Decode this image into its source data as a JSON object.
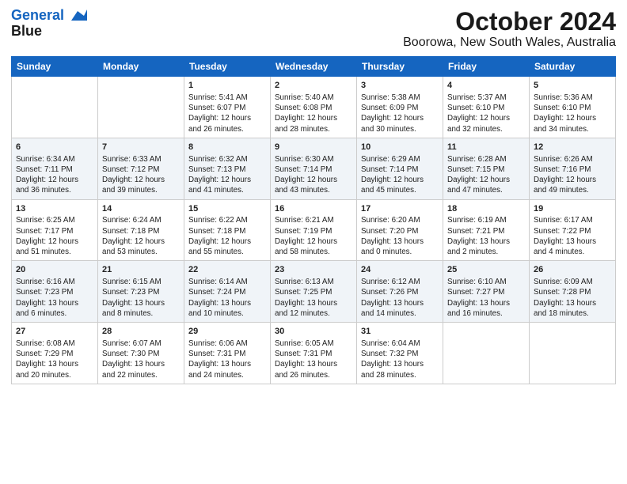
{
  "logo": {
    "line1": "General",
    "line2": "Blue"
  },
  "title": "October 2024",
  "subtitle": "Boorowa, New South Wales, Australia",
  "days_of_week": [
    "Sunday",
    "Monday",
    "Tuesday",
    "Wednesday",
    "Thursday",
    "Friday",
    "Saturday"
  ],
  "weeks": [
    [
      {
        "day": "",
        "info": ""
      },
      {
        "day": "",
        "info": ""
      },
      {
        "day": "1",
        "info": "Sunrise: 5:41 AM\nSunset: 6:07 PM\nDaylight: 12 hours and 26 minutes."
      },
      {
        "day": "2",
        "info": "Sunrise: 5:40 AM\nSunset: 6:08 PM\nDaylight: 12 hours and 28 minutes."
      },
      {
        "day": "3",
        "info": "Sunrise: 5:38 AM\nSunset: 6:09 PM\nDaylight: 12 hours and 30 minutes."
      },
      {
        "day": "4",
        "info": "Sunrise: 5:37 AM\nSunset: 6:10 PM\nDaylight: 12 hours and 32 minutes."
      },
      {
        "day": "5",
        "info": "Sunrise: 5:36 AM\nSunset: 6:10 PM\nDaylight: 12 hours and 34 minutes."
      }
    ],
    [
      {
        "day": "6",
        "info": "Sunrise: 6:34 AM\nSunset: 7:11 PM\nDaylight: 12 hours and 36 minutes."
      },
      {
        "day": "7",
        "info": "Sunrise: 6:33 AM\nSunset: 7:12 PM\nDaylight: 12 hours and 39 minutes."
      },
      {
        "day": "8",
        "info": "Sunrise: 6:32 AM\nSunset: 7:13 PM\nDaylight: 12 hours and 41 minutes."
      },
      {
        "day": "9",
        "info": "Sunrise: 6:30 AM\nSunset: 7:14 PM\nDaylight: 12 hours and 43 minutes."
      },
      {
        "day": "10",
        "info": "Sunrise: 6:29 AM\nSunset: 7:14 PM\nDaylight: 12 hours and 45 minutes."
      },
      {
        "day": "11",
        "info": "Sunrise: 6:28 AM\nSunset: 7:15 PM\nDaylight: 12 hours and 47 minutes."
      },
      {
        "day": "12",
        "info": "Sunrise: 6:26 AM\nSunset: 7:16 PM\nDaylight: 12 hours and 49 minutes."
      }
    ],
    [
      {
        "day": "13",
        "info": "Sunrise: 6:25 AM\nSunset: 7:17 PM\nDaylight: 12 hours and 51 minutes."
      },
      {
        "day": "14",
        "info": "Sunrise: 6:24 AM\nSunset: 7:18 PM\nDaylight: 12 hours and 53 minutes."
      },
      {
        "day": "15",
        "info": "Sunrise: 6:22 AM\nSunset: 7:18 PM\nDaylight: 12 hours and 55 minutes."
      },
      {
        "day": "16",
        "info": "Sunrise: 6:21 AM\nSunset: 7:19 PM\nDaylight: 12 hours and 58 minutes."
      },
      {
        "day": "17",
        "info": "Sunrise: 6:20 AM\nSunset: 7:20 PM\nDaylight: 13 hours and 0 minutes."
      },
      {
        "day": "18",
        "info": "Sunrise: 6:19 AM\nSunset: 7:21 PM\nDaylight: 13 hours and 2 minutes."
      },
      {
        "day": "19",
        "info": "Sunrise: 6:17 AM\nSunset: 7:22 PM\nDaylight: 13 hours and 4 minutes."
      }
    ],
    [
      {
        "day": "20",
        "info": "Sunrise: 6:16 AM\nSunset: 7:23 PM\nDaylight: 13 hours and 6 minutes."
      },
      {
        "day": "21",
        "info": "Sunrise: 6:15 AM\nSunset: 7:23 PM\nDaylight: 13 hours and 8 minutes."
      },
      {
        "day": "22",
        "info": "Sunrise: 6:14 AM\nSunset: 7:24 PM\nDaylight: 13 hours and 10 minutes."
      },
      {
        "day": "23",
        "info": "Sunrise: 6:13 AM\nSunset: 7:25 PM\nDaylight: 13 hours and 12 minutes."
      },
      {
        "day": "24",
        "info": "Sunrise: 6:12 AM\nSunset: 7:26 PM\nDaylight: 13 hours and 14 minutes."
      },
      {
        "day": "25",
        "info": "Sunrise: 6:10 AM\nSunset: 7:27 PM\nDaylight: 13 hours and 16 minutes."
      },
      {
        "day": "26",
        "info": "Sunrise: 6:09 AM\nSunset: 7:28 PM\nDaylight: 13 hours and 18 minutes."
      }
    ],
    [
      {
        "day": "27",
        "info": "Sunrise: 6:08 AM\nSunset: 7:29 PM\nDaylight: 13 hours and 20 minutes."
      },
      {
        "day": "28",
        "info": "Sunrise: 6:07 AM\nSunset: 7:30 PM\nDaylight: 13 hours and 22 minutes."
      },
      {
        "day": "29",
        "info": "Sunrise: 6:06 AM\nSunset: 7:31 PM\nDaylight: 13 hours and 24 minutes."
      },
      {
        "day": "30",
        "info": "Sunrise: 6:05 AM\nSunset: 7:31 PM\nDaylight: 13 hours and 26 minutes."
      },
      {
        "day": "31",
        "info": "Sunrise: 6:04 AM\nSunset: 7:32 PM\nDaylight: 13 hours and 28 minutes."
      },
      {
        "day": "",
        "info": ""
      },
      {
        "day": "",
        "info": ""
      }
    ]
  ]
}
